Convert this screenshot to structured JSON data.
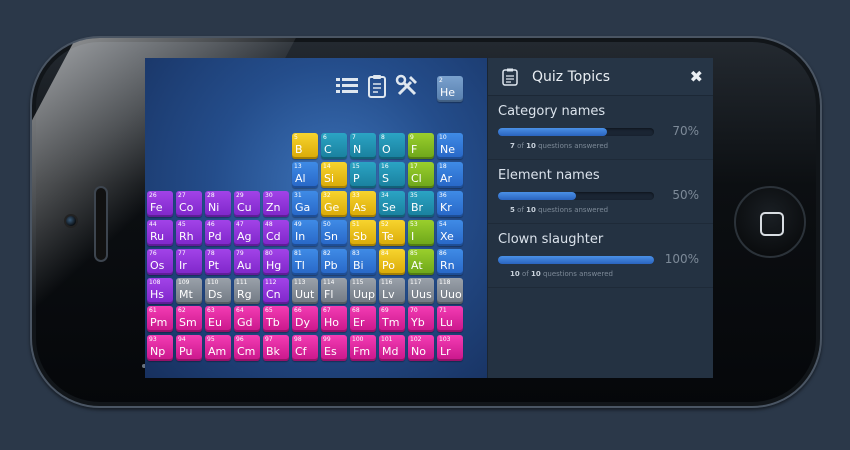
{
  "panel": {
    "title": "Quiz Topics",
    "close_icon": "close-icon",
    "topics": [
      {
        "name": "Category names",
        "percent_label": "70%",
        "progress": 0.7,
        "answered": "7",
        "total": "10",
        "answered_text": "questions answered",
        "of_text": "of"
      },
      {
        "name": "Element names",
        "percent_label": "50%",
        "progress": 0.5,
        "answered": "5",
        "total": "10",
        "answered_text": "questions answered",
        "of_text": "of"
      },
      {
        "name": "Clown slaughter",
        "percent_label": "100%",
        "progress": 1.0,
        "answered": "10",
        "total": "10",
        "answered_text": "questions answered",
        "of_text": "of"
      }
    ]
  },
  "toolbar": {
    "icons": [
      "list-icon",
      "clipboard-icon",
      "tools-icon"
    ]
  },
  "elements": [
    {
      "n": "2",
      "s": "He",
      "c": "steel",
      "r": 0,
      "col": 17
    },
    {
      "n": "5",
      "s": "B",
      "c": "yellow",
      "r": 1,
      "col": 12
    },
    {
      "n": "6",
      "s": "C",
      "c": "teal",
      "r": 1,
      "col": 13
    },
    {
      "n": "7",
      "s": "N",
      "c": "teal",
      "r": 1,
      "col": 14
    },
    {
      "n": "8",
      "s": "O",
      "c": "teal",
      "r": 1,
      "col": 15
    },
    {
      "n": "9",
      "s": "F",
      "c": "green",
      "r": 1,
      "col": 16
    },
    {
      "n": "10",
      "s": "Ne",
      "c": "blue",
      "r": 1,
      "col": 17
    },
    {
      "n": "13",
      "s": "Al",
      "c": "blue",
      "r": 2,
      "col": 12
    },
    {
      "n": "14",
      "s": "Si",
      "c": "yellow",
      "r": 2,
      "col": 13
    },
    {
      "n": "15",
      "s": "P",
      "c": "teal",
      "r": 2,
      "col": 14
    },
    {
      "n": "16",
      "s": "S",
      "c": "teal",
      "r": 2,
      "col": 15
    },
    {
      "n": "17",
      "s": "Cl",
      "c": "green",
      "r": 2,
      "col": 16
    },
    {
      "n": "18",
      "s": "Ar",
      "c": "blue",
      "r": 2,
      "col": 17
    },
    {
      "n": "26",
      "s": "Fe",
      "c": "purple",
      "r": 3,
      "col": 7
    },
    {
      "n": "27",
      "s": "Co",
      "c": "purple",
      "r": 3,
      "col": 8
    },
    {
      "n": "28",
      "s": "Ni",
      "c": "purple",
      "r": 3,
      "col": 9
    },
    {
      "n": "29",
      "s": "Cu",
      "c": "purple",
      "r": 3,
      "col": 10
    },
    {
      "n": "30",
      "s": "Zn",
      "c": "purple",
      "r": 3,
      "col": 11
    },
    {
      "n": "31",
      "s": "Ga",
      "c": "blue",
      "r": 3,
      "col": 12
    },
    {
      "n": "32",
      "s": "Ge",
      "c": "yellow",
      "r": 3,
      "col": 13
    },
    {
      "n": "33",
      "s": "As",
      "c": "yellow",
      "r": 3,
      "col": 14
    },
    {
      "n": "34",
      "s": "Se",
      "c": "teal",
      "r": 3,
      "col": 15
    },
    {
      "n": "35",
      "s": "Br",
      "c": "teal",
      "r": 3,
      "col": 16
    },
    {
      "n": "36",
      "s": "Kr",
      "c": "blue",
      "r": 3,
      "col": 17
    },
    {
      "n": "44",
      "s": "Ru",
      "c": "purple",
      "r": 4,
      "col": 7
    },
    {
      "n": "45",
      "s": "Rh",
      "c": "purple",
      "r": 4,
      "col": 8
    },
    {
      "n": "46",
      "s": "Pd",
      "c": "purple",
      "r": 4,
      "col": 9
    },
    {
      "n": "47",
      "s": "Ag",
      "c": "purple",
      "r": 4,
      "col": 10
    },
    {
      "n": "48",
      "s": "Cd",
      "c": "purple",
      "r": 4,
      "col": 11
    },
    {
      "n": "49",
      "s": "In",
      "c": "blue",
      "r": 4,
      "col": 12
    },
    {
      "n": "50",
      "s": "Sn",
      "c": "blue",
      "r": 4,
      "col": 13
    },
    {
      "n": "51",
      "s": "Sb",
      "c": "yellow",
      "r": 4,
      "col": 14
    },
    {
      "n": "52",
      "s": "Te",
      "c": "yellow",
      "r": 4,
      "col": 15
    },
    {
      "n": "53",
      "s": "I",
      "c": "green",
      "r": 4,
      "col": 16
    },
    {
      "n": "54",
      "s": "Xe",
      "c": "blue",
      "r": 4,
      "col": 17
    },
    {
      "n": "76",
      "s": "Os",
      "c": "purple",
      "r": 5,
      "col": 7
    },
    {
      "n": "77",
      "s": "Ir",
      "c": "purple",
      "r": 5,
      "col": 8
    },
    {
      "n": "78",
      "s": "Pt",
      "c": "purple",
      "r": 5,
      "col": 9
    },
    {
      "n": "79",
      "s": "Au",
      "c": "purple",
      "r": 5,
      "col": 10
    },
    {
      "n": "80",
      "s": "Hg",
      "c": "purple",
      "r": 5,
      "col": 11
    },
    {
      "n": "81",
      "s": "Tl",
      "c": "blue",
      "r": 5,
      "col": 12
    },
    {
      "n": "82",
      "s": "Pb",
      "c": "blue",
      "r": 5,
      "col": 13
    },
    {
      "n": "83",
      "s": "Bi",
      "c": "blue",
      "r": 5,
      "col": 14
    },
    {
      "n": "84",
      "s": "Po",
      "c": "yellow",
      "r": 5,
      "col": 15
    },
    {
      "n": "85",
      "s": "At",
      "c": "green",
      "r": 5,
      "col": 16
    },
    {
      "n": "86",
      "s": "Rn",
      "c": "blue",
      "r": 5,
      "col": 17
    },
    {
      "n": "108",
      "s": "Hs",
      "c": "purple",
      "r": 6,
      "col": 7
    },
    {
      "n": "109",
      "s": "Mt",
      "c": "gray",
      "r": 6,
      "col": 8
    },
    {
      "n": "110",
      "s": "Ds",
      "c": "gray",
      "r": 6,
      "col": 9
    },
    {
      "n": "111",
      "s": "Rg",
      "c": "gray",
      "r": 6,
      "col": 10
    },
    {
      "n": "112",
      "s": "Cn",
      "c": "purple",
      "r": 6,
      "col": 11
    },
    {
      "n": "113",
      "s": "Uut",
      "c": "gray",
      "r": 6,
      "col": 12
    },
    {
      "n": "114",
      "s": "Fl",
      "c": "gray",
      "r": 6,
      "col": 13
    },
    {
      "n": "115",
      "s": "Uup",
      "c": "gray",
      "r": 6,
      "col": 14
    },
    {
      "n": "116",
      "s": "Lv",
      "c": "gray",
      "r": 6,
      "col": 15
    },
    {
      "n": "117",
      "s": "Uus",
      "c": "gray",
      "r": 6,
      "col": 16
    },
    {
      "n": "118",
      "s": "Uuo",
      "c": "gray",
      "r": 6,
      "col": 17
    },
    {
      "n": "61",
      "s": "Pm",
      "c": "pink",
      "r": 8,
      "col": 7
    },
    {
      "n": "62",
      "s": "Sm",
      "c": "pink",
      "r": 8,
      "col": 8
    },
    {
      "n": "63",
      "s": "Eu",
      "c": "pink",
      "r": 8,
      "col": 9
    },
    {
      "n": "64",
      "s": "Gd",
      "c": "pink",
      "r": 8,
      "col": 10
    },
    {
      "n": "65",
      "s": "Tb",
      "c": "pink",
      "r": 8,
      "col": 11
    },
    {
      "n": "66",
      "s": "Dy",
      "c": "pink",
      "r": 8,
      "col": 12
    },
    {
      "n": "67",
      "s": "Ho",
      "c": "pink",
      "r": 8,
      "col": 13
    },
    {
      "n": "68",
      "s": "Er",
      "c": "pink",
      "r": 8,
      "col": 14
    },
    {
      "n": "69",
      "s": "Tm",
      "c": "pink",
      "r": 8,
      "col": 15
    },
    {
      "n": "70",
      "s": "Yb",
      "c": "pink",
      "r": 8,
      "col": 16
    },
    {
      "n": "71",
      "s": "Lu",
      "c": "pink",
      "r": 8,
      "col": 17
    },
    {
      "n": "93",
      "s": "Np",
      "c": "pink",
      "r": 9,
      "col": 7
    },
    {
      "n": "94",
      "s": "Pu",
      "c": "pink",
      "r": 9,
      "col": 8
    },
    {
      "n": "95",
      "s": "Am",
      "c": "pink",
      "r": 9,
      "col": 9
    },
    {
      "n": "96",
      "s": "Cm",
      "c": "pink",
      "r": 9,
      "col": 10
    },
    {
      "n": "97",
      "s": "Bk",
      "c": "pink",
      "r": 9,
      "col": 11
    },
    {
      "n": "98",
      "s": "Cf",
      "c": "pink",
      "r": 9,
      "col": 12
    },
    {
      "n": "99",
      "s": "Es",
      "c": "pink",
      "r": 9,
      "col": 13
    },
    {
      "n": "100",
      "s": "Fm",
      "c": "pink",
      "r": 9,
      "col": 14
    },
    {
      "n": "101",
      "s": "Md",
      "c": "pink",
      "r": 9,
      "col": 15
    },
    {
      "n": "102",
      "s": "No",
      "c": "pink",
      "r": 9,
      "col": 16
    },
    {
      "n": "103",
      "s": "Lr",
      "c": "pink",
      "r": 9,
      "col": 17
    }
  ]
}
